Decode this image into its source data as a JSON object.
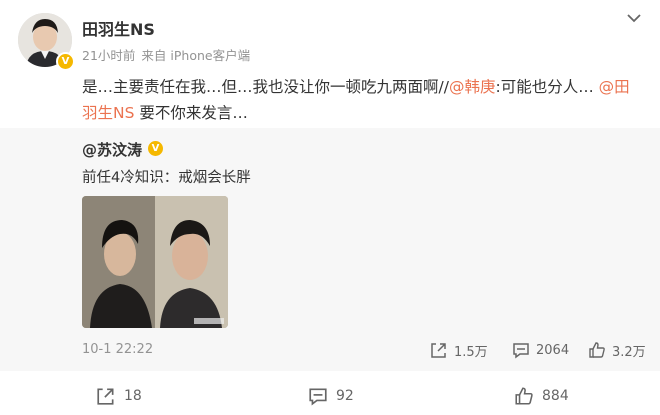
{
  "post": {
    "author": "田羽生NS",
    "time": "21小时前",
    "source": "来自 iPhone客户端",
    "text_part1": "是…主要责任在我…但…我也没让你一顿吃九两面啊//",
    "mention1": "@韩庚",
    "text_part2": ":可能也分人… ",
    "mention2": "@田羽生NS",
    "text_part3": " 要不你来发言…"
  },
  "repost": {
    "author": "@苏汶涛",
    "text": "前任4冷知识：戒烟会长胖",
    "time": "10-1 22:22",
    "repost_count": "1.5万",
    "comment_count": "2064",
    "like_count": "3.2万"
  },
  "footer": {
    "repost_count": "18",
    "comment_count": "92",
    "like_count": "884"
  },
  "colors": {
    "mention": "#eb7350",
    "verified_badge": "#f5b800",
    "repost_background": "#f7f7f7"
  }
}
